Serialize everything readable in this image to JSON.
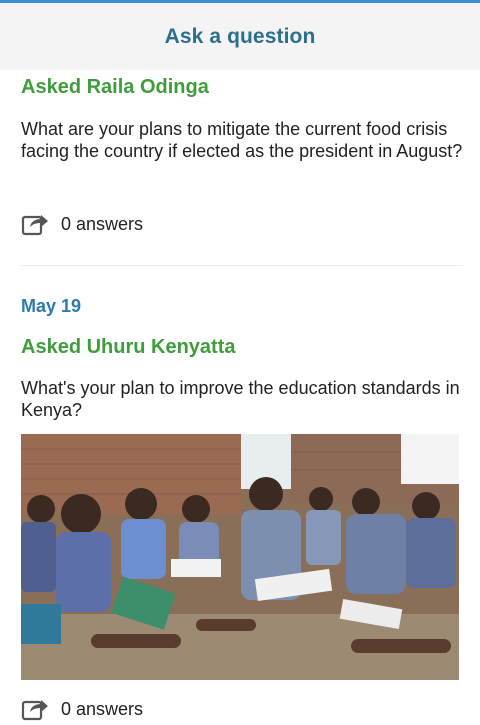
{
  "header": {
    "title": "Ask a question"
  },
  "posts": [
    {
      "asked": "Asked Raila Odinga",
      "question": "What are your plans to mitigate the current food crisis facing the country if elected as the president in August?",
      "answers": "0 answers"
    },
    {
      "date": "May 19",
      "asked": "Asked Uhuru Kenyatta",
      "question": "What's your plan to improve the education standards in Kenya?",
      "answers": "0 answers"
    }
  ],
  "icons": {
    "share": "share-forward-icon"
  },
  "colors": {
    "accent_green": "#3f9d3c",
    "title_blue": "#2b6e8f",
    "date_blue": "#2b7ab0"
  }
}
